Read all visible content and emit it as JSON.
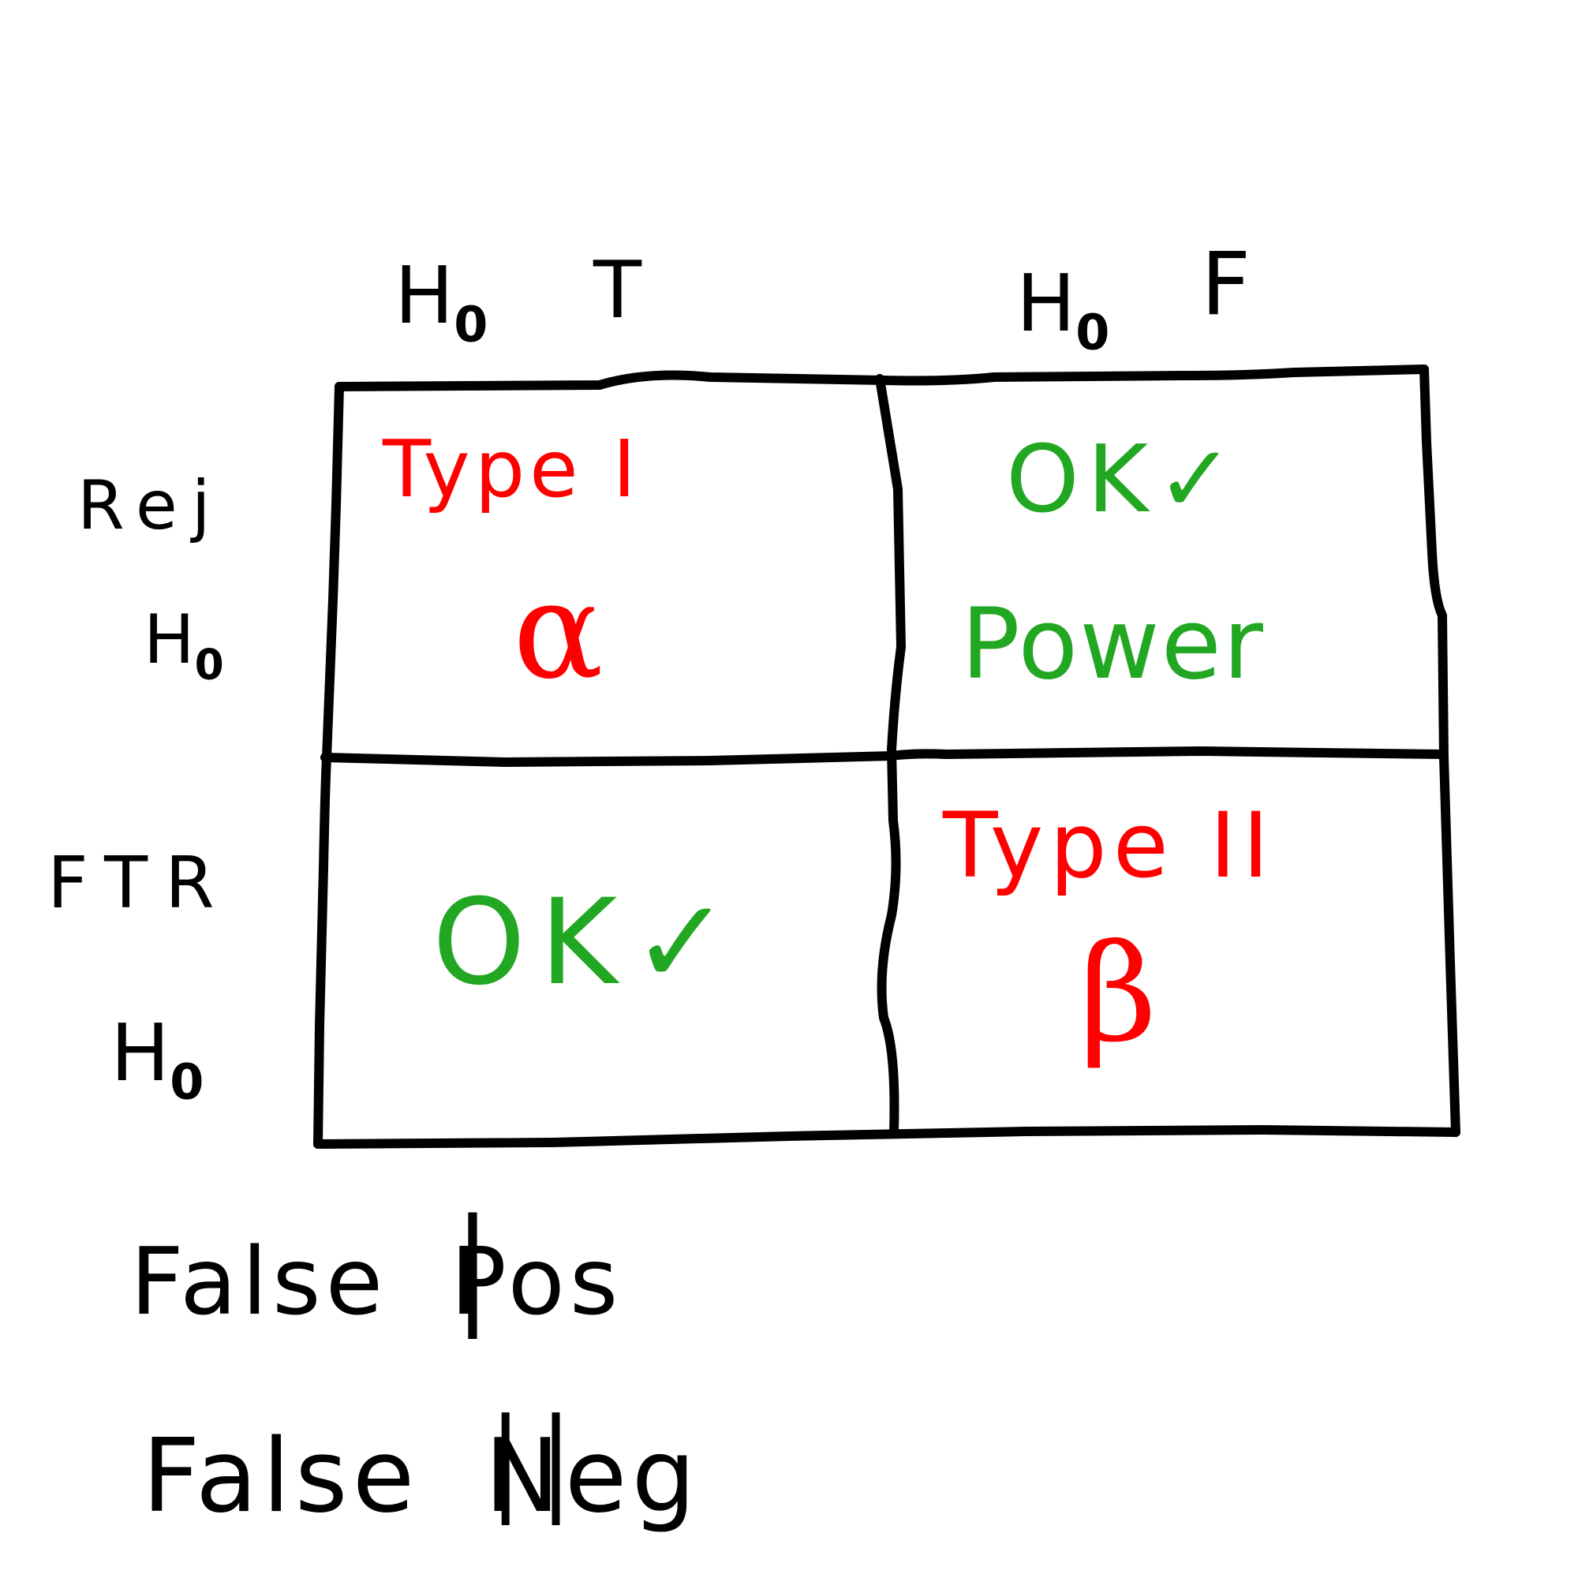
{
  "colors": {
    "ink": "#000000",
    "error": "#ff0000",
    "ok": "#22a722"
  },
  "columns": {
    "true_col": {
      "main": "H",
      "sub": "0",
      "state": "T"
    },
    "false_col": {
      "main": "H",
      "sub": "0",
      "state": "F"
    }
  },
  "rows": {
    "reject": {
      "line1": "Rej",
      "main": "H",
      "sub": "0"
    },
    "ftr": {
      "line1": "FTR",
      "main": "H",
      "sub": "0"
    }
  },
  "cells": {
    "reject_true": {
      "label": "Type I",
      "symbol": "α"
    },
    "reject_false": {
      "label": "OK",
      "check": "✓",
      "sub_label": "Power"
    },
    "ftr_true": {
      "label": "OK",
      "check": "✓"
    },
    "ftr_false": {
      "label": "Type II",
      "symbol": "β"
    }
  },
  "notes": {
    "type1": {
      "prefix": "False",
      "rest": "Pos"
    },
    "type2": {
      "prefix": "False",
      "rest": "Neg"
    }
  }
}
